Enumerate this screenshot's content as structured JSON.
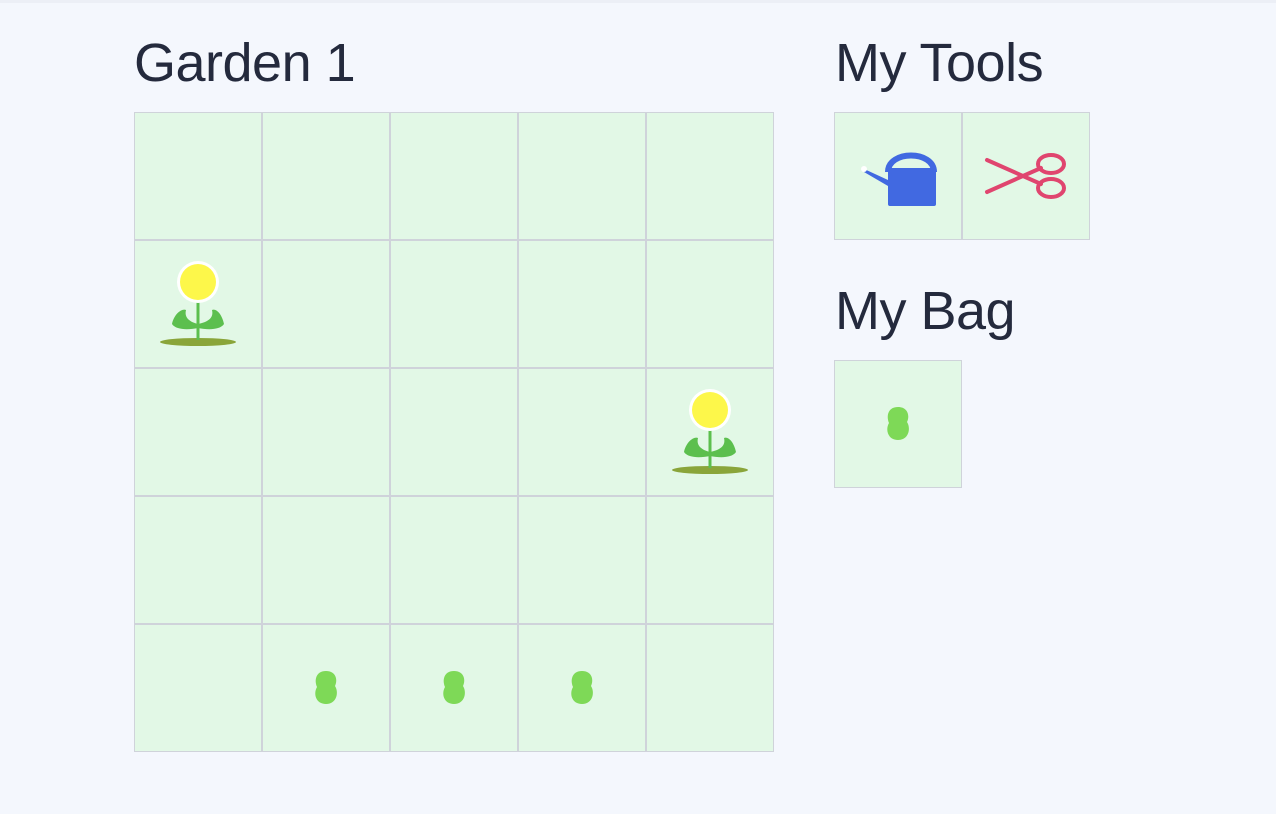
{
  "garden": {
    "title": "Garden 1",
    "rows": 5,
    "cols": 5,
    "cells": [
      [
        "empty",
        "empty",
        "empty",
        "empty",
        "empty"
      ],
      [
        "flower",
        "empty",
        "empty",
        "empty",
        "empty"
      ],
      [
        "empty",
        "empty",
        "empty",
        "empty",
        "flower"
      ],
      [
        "empty",
        "empty",
        "empty",
        "empty",
        "empty"
      ],
      [
        "empty",
        "seed",
        "seed",
        "seed",
        "empty"
      ]
    ]
  },
  "tools": {
    "title": "My Tools",
    "items": [
      {
        "name": "watering-can-icon",
        "color": "#4169e1"
      },
      {
        "name": "scissors-icon",
        "color": "#e0456f"
      }
    ]
  },
  "bag": {
    "title": "My Bag",
    "items": [
      {
        "name": "seed-icon",
        "color": "#7ed957"
      }
    ]
  },
  "colors": {
    "background": "#f4f7fd",
    "cell": "#e2f8e6",
    "cell_border": "#cfd3da",
    "flower_petal": "#fdf74a",
    "leaf": "#5cbf4e",
    "seed": "#7ed957"
  }
}
